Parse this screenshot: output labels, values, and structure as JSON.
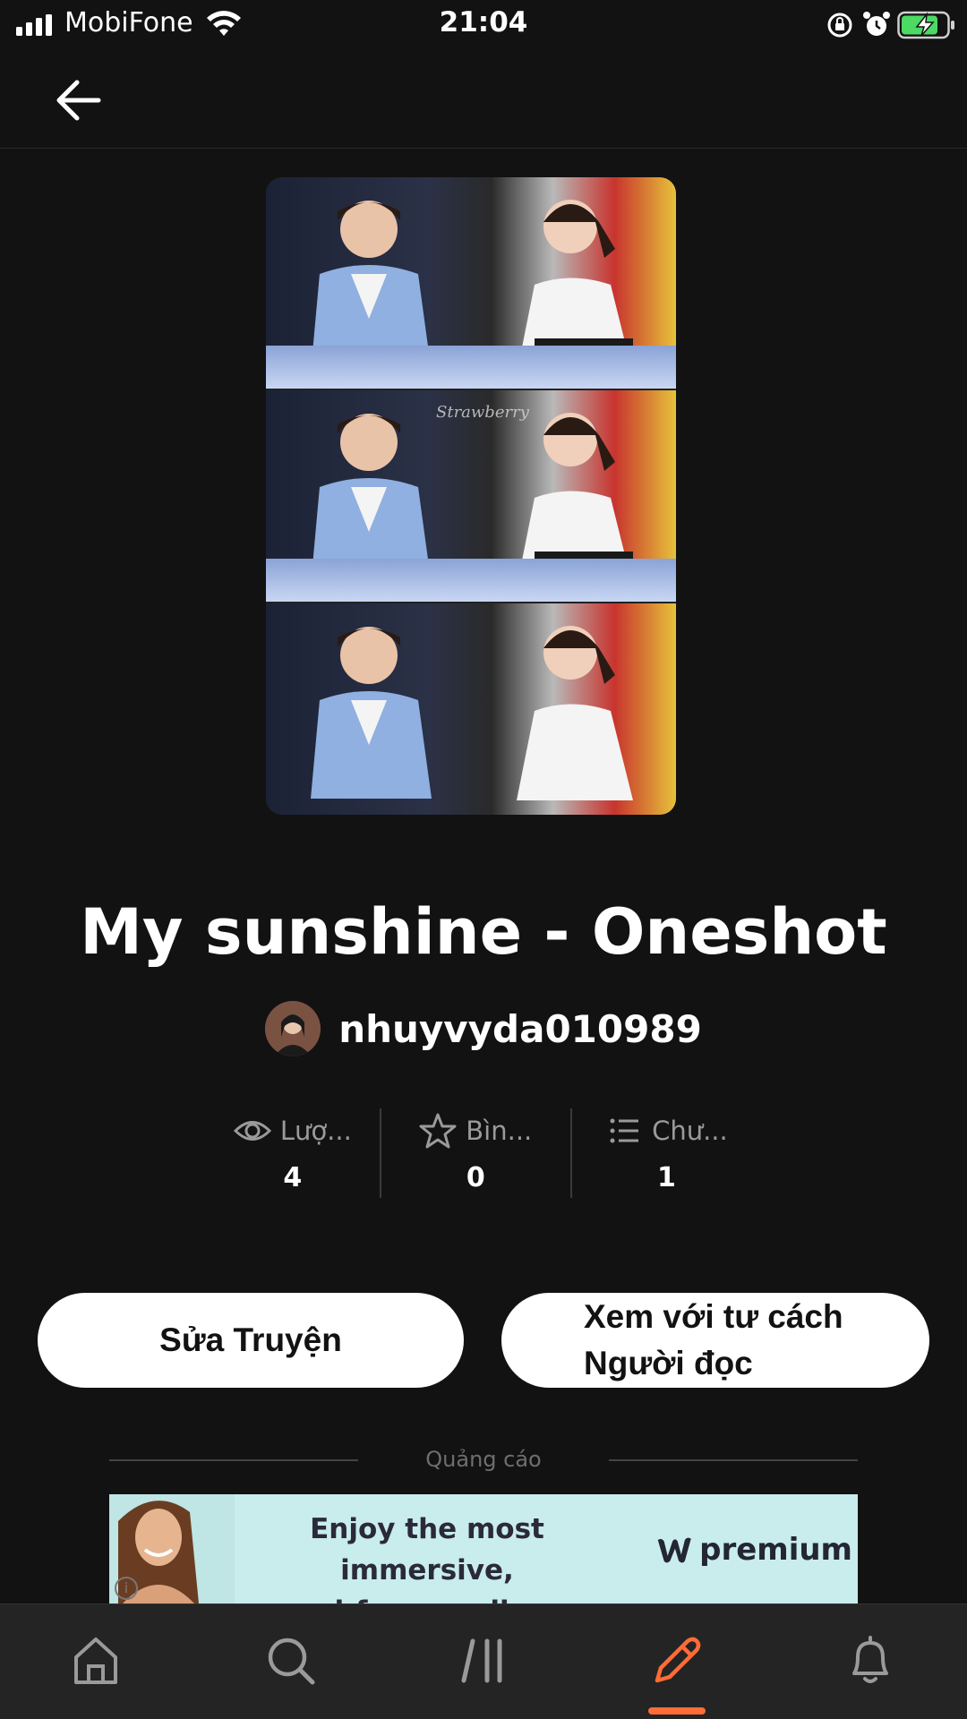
{
  "status_bar": {
    "carrier": "MobiFone",
    "time": "21:04",
    "battery_color": "#4cd964"
  },
  "header": {
    "back_icon": "arrow-left-icon"
  },
  "story": {
    "title": "My sunshine - Oneshot",
    "author": "nhuyvyda010989",
    "cover_watermark": "Strawberry"
  },
  "stats": [
    {
      "icon": "eye-icon",
      "label": "Lượ...",
      "value": "4"
    },
    {
      "icon": "star-icon",
      "label": "Bìn...",
      "value": "0"
    },
    {
      "icon": "list-icon",
      "label": "Chư...",
      "value": "1"
    }
  ],
  "actions": {
    "edit_label": "Sửa Truyện",
    "reader_label": "Xem với tư cách Người đọc"
  },
  "ad": {
    "label": "Quảng cáo",
    "line1": "Enjoy the most immersive,",
    "line2": "ad-free reading experience.",
    "brand": "premium",
    "info": "i"
  },
  "nav": {
    "items": [
      "home-icon",
      "search-icon",
      "library-icon",
      "write-icon",
      "bell-icon"
    ],
    "active": "write-icon",
    "accent": "#ff6c37"
  }
}
